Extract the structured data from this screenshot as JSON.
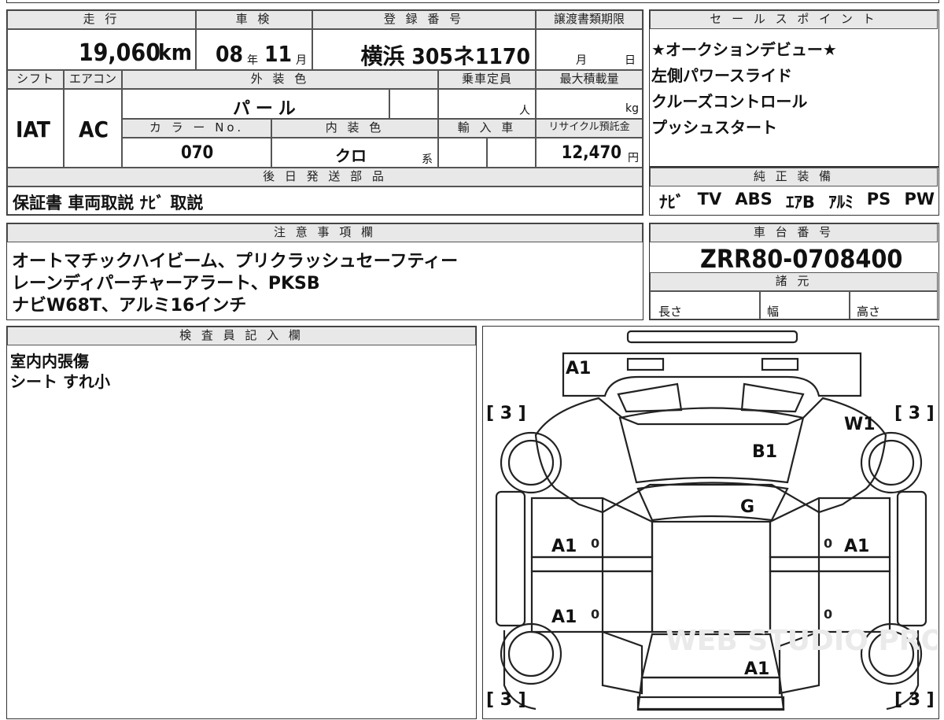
{
  "header": {
    "mileage_label": "走 行",
    "mileage_value": "19,060",
    "mileage_unit": "km",
    "inspection_label": "車 検",
    "inspection_year": "08",
    "inspection_year_unit": "年",
    "inspection_month": "11",
    "inspection_month_unit": "月",
    "registration_label": "登 録 番 号",
    "registration_value": "横浜 305ネ1170",
    "transfer_label": "譲渡書類期限",
    "transfer_month": "月",
    "transfer_day": "日",
    "shift_label": "シフト",
    "shift_value": "IAT",
    "ac_label": "エアコン",
    "ac_value": "AC",
    "exterior_label": "外 装 色",
    "exterior_value": "パ ー ル",
    "capacity_label": "乗車定員",
    "capacity_unit": "人",
    "max_load_label": "最大積載量",
    "max_load_unit": "kg",
    "color_no_label": "カ ラ ー No.",
    "color_no_value": "070",
    "interior_label": "内 装 色",
    "interior_value": "クロ",
    "interior_suffix": "系",
    "import_label": "輸 入 車",
    "recycle_label": "リサイクル預託金",
    "recycle_value": "12,470",
    "recycle_unit": "円",
    "later_parts_label": "後 日 発 送 部 品",
    "later_parts_value": "保証書 車両取説 ﾅﾋﾞ 取説"
  },
  "sales": {
    "label": "セ ー ル ス ポ イ ン ト",
    "points": [
      "★オークションデビュー★",
      "左側パワースライド",
      "クルーズコントロール",
      "プッシュスタート"
    ]
  },
  "equipment": {
    "label": "純 正 装 備",
    "items": [
      "ﾅﾋﾞ",
      "TV",
      "ABS",
      "ｴｱB",
      "ｱﾙﾐ",
      "PS",
      "PW"
    ]
  },
  "notes": {
    "label": "注 意 事 項 欄",
    "lines": [
      "オートマチックハイビーム、プリクラッシュセーフティー",
      "レーンディパーチャーアラート、PKSB",
      "ナビW68T、アルミ16インチ"
    ]
  },
  "chassis": {
    "label": "車 台 番 号",
    "value": "ZRR80-0708400",
    "spec_label": "諸 元",
    "length_label": "長さ",
    "width_label": "幅",
    "height_label": "高さ"
  },
  "inspector": {
    "label": "検 査 員 記 入 欄",
    "lines": [
      "室内内張傷",
      "シート すれ小"
    ]
  },
  "diagram": {
    "marks": [
      "A1",
      "W1",
      "B1",
      "G",
      "A1",
      "A1",
      "A1",
      "A1"
    ],
    "tire_fl": "[ 3 ]",
    "tire_fr": "[ 3 ]",
    "tire_rl": "[ 3 ]",
    "tire_rr": "[ 3 ]",
    "zero_1": "0",
    "zero_2": "0",
    "zero_3": "0",
    "zero_4": "0",
    "watermark": "WEB STUDIO PRO"
  }
}
